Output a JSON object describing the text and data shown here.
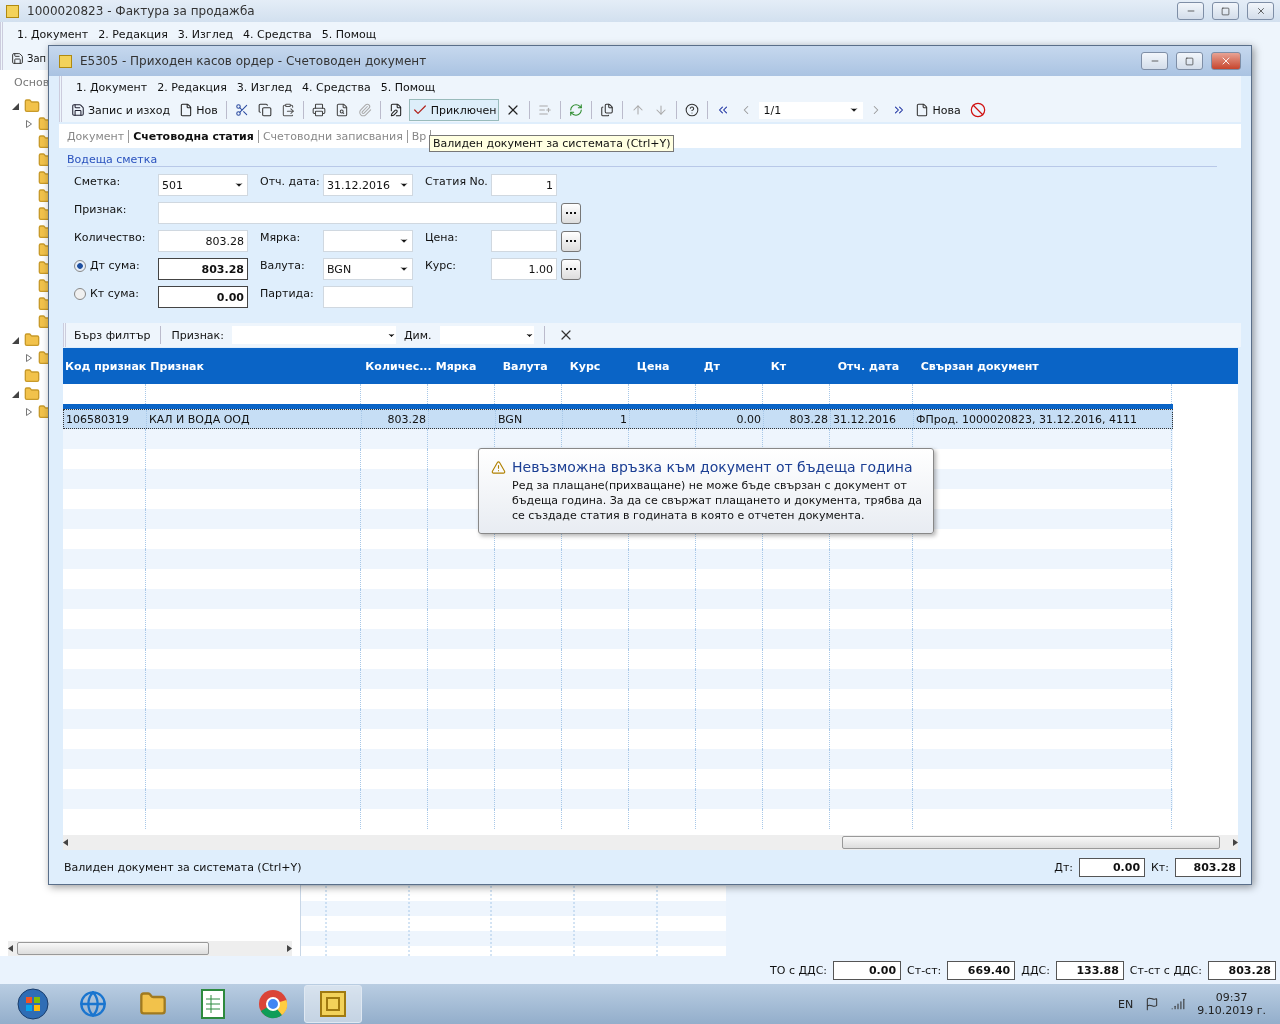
{
  "back_window": {
    "title": "1000020823 - Фактура за продажба",
    "menu": [
      "1. Документ",
      "2. Редакция",
      "3. Изглед",
      "4. Средства",
      "5. Помощ"
    ],
    "toolbar_label": "Зап",
    "tab_label": "Основ",
    "tree": [
      {
        "kind": "branch",
        "expanded": true,
        "children": [
          {
            "kind": "branch",
            "expanded": false
          },
          {
            "kind": "folder"
          },
          {
            "kind": "folder"
          },
          {
            "kind": "folder"
          },
          {
            "kind": "folder"
          },
          {
            "kind": "folder"
          },
          {
            "kind": "folder"
          },
          {
            "kind": "folder"
          },
          {
            "kind": "folder"
          },
          {
            "kind": "folder"
          },
          {
            "kind": "folder"
          },
          {
            "kind": "folder"
          }
        ]
      },
      {
        "kind": "branch",
        "expanded": true,
        "children": [
          {
            "kind": "branch",
            "expanded": false
          }
        ]
      },
      {
        "kind": "folder"
      },
      {
        "kind": "branch",
        "expanded": true,
        "children": [
          {
            "kind": "branch",
            "expanded": false
          }
        ]
      }
    ],
    "totals": [
      {
        "label": "ТО с ДДС:",
        "value": "0.00"
      },
      {
        "label": "Ст-ст:",
        "value": "669.40"
      },
      {
        "label": "ДДС:",
        "value": "133.88"
      },
      {
        "label": "Ст-ст с ДДС:",
        "value": "803.28"
      }
    ]
  },
  "dialog": {
    "title": "E5305 - Приходен касов ордер - Счетоводен документ",
    "menu": [
      "1. Документ",
      "2. Редакция",
      "3. Изглед",
      "4. Средства",
      "5. Помощ"
    ],
    "toolbar": {
      "save": "Запис и изход",
      "new": "Нов",
      "closed": {
        "label": "Приключен",
        "pressed": true
      },
      "record": "1/1",
      "new_record": "Нова"
    },
    "tabs": [
      {
        "label": "Документ",
        "selected": false
      },
      {
        "label": "Счетоводна статия",
        "selected": true
      },
      {
        "label": "Счетоводни записвания",
        "selected": false
      },
      {
        "label": "Вр",
        "selected": false
      }
    ],
    "tooltip": "Валиден документ за системата (Ctrl+Y)",
    "section": "Водеща сметка",
    "form": {
      "account": {
        "label": "Сметка:",
        "value": "501"
      },
      "report_date": {
        "label": "Отч. дата:",
        "value": "31.12.2016"
      },
      "entry_no": {
        "label": "Статия No.",
        "value": "1"
      },
      "attribute": {
        "label": "Признак:"
      },
      "quantity": {
        "label": "Количество:",
        "value": "803.28"
      },
      "unit": {
        "label": "Мярка:"
      },
      "price": {
        "label": "Цена:"
      },
      "debit": {
        "label": "Дт сума:",
        "value": "803.28",
        "selected": true
      },
      "currency": {
        "label": "Валута:",
        "value": "BGN"
      },
      "rate": {
        "label": "Курс:",
        "value": "1.00"
      },
      "credit": {
        "label": "Кт сума:",
        "value": "0.00",
        "selected": false
      },
      "batch": {
        "label": "Партида:"
      }
    },
    "filter": {
      "title": "Бърз филтър",
      "attribute_label": "Признак:",
      "dim_label": "Дим."
    },
    "grid": {
      "columns": [
        "Код признак",
        "Признак",
        "Количес...",
        "Мярка",
        "Валута",
        "Курс",
        "Цена",
        "Дт",
        "Кт",
        "Отч. дата",
        "Свързан документ"
      ],
      "rows": [
        {
          "selected": true,
          "cells": [
            "106580319",
            "КАЛ И ВОДА ООД",
            "803.28",
            "",
            "BGN",
            "1",
            "",
            "0.00",
            "803.28",
            "31.12.2016",
            "ФПрод. 1000020823, 31.12.2016, 4111"
          ]
        }
      ]
    },
    "balloon": {
      "title": "Невъзможна връзка към документ от бъдеща година",
      "text": "Ред за плащане(прихващане) не може бъде свързан с документ от бъдеща година. За да се свържат плащането и документа, трябва да се създаде статия в годината в която е отчетен документа."
    },
    "status": {
      "text": "Валиден документ за системата (Ctrl+Y)",
      "debit_label": "Дт:",
      "debit": "0.00",
      "credit_label": "Кт:",
      "credit": "803.28"
    }
  },
  "taskbar": {
    "apps": [
      {
        "kind": "start",
        "selected": false
      },
      {
        "kind": "browser",
        "selected": false
      },
      {
        "kind": "explorer",
        "selected": false
      },
      {
        "kind": "spreadsheet",
        "selected": false
      },
      {
        "kind": "chrome",
        "selected": false
      },
      {
        "kind": "app",
        "selected": true
      }
    ],
    "language": "EN",
    "time": "09:37",
    "date": "9.10.2019 г."
  }
}
